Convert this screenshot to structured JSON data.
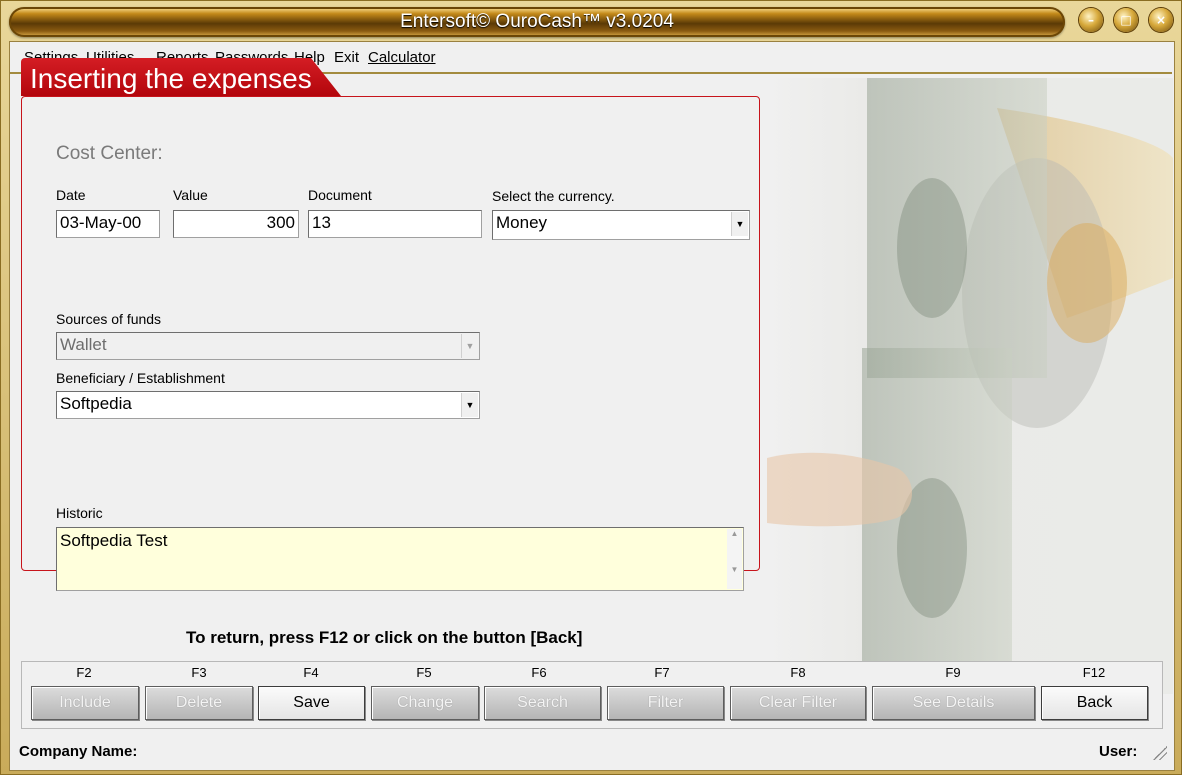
{
  "window": {
    "title": "Entersoft© OuroCash™ v3.0204"
  },
  "menu": [
    "Settings",
    "Utilities",
    "Reports",
    "Passwords",
    "Help",
    "Exit",
    "Calculator"
  ],
  "panel": {
    "tab_title": "Inserting the expenses",
    "cost_center": "Cost Center:",
    "date_label": "Date",
    "date_value": "03-May-00",
    "value_label": "Value",
    "value_value": "300",
    "document_label": "Document",
    "document_value": "13",
    "currency_label": "Select the currency.",
    "currency_value": "Money",
    "sources_label": "Sources of funds",
    "sources_value": "Wallet",
    "beneficiary_label": "Beneficiary / Establishment",
    "beneficiary_value": "Softpedia",
    "historic_label": "Historic",
    "historic_value": "Softpedia Test"
  },
  "hint": "To return, press F12 or click on the button [Back]",
  "buttons": [
    {
      "key": "F2",
      "label": "Include",
      "enabled": false
    },
    {
      "key": "F3",
      "label": "Delete",
      "enabled": false
    },
    {
      "key": "F4",
      "label": "Save",
      "enabled": true
    },
    {
      "key": "F5",
      "label": "Change",
      "enabled": false
    },
    {
      "key": "F6",
      "label": "Search",
      "enabled": false
    },
    {
      "key": "F7",
      "label": "Filter",
      "enabled": false
    },
    {
      "key": "F8",
      "label": "Clear Filter",
      "enabled": false
    },
    {
      "key": "F9",
      "label": "See Details",
      "enabled": false
    },
    {
      "key": "F12",
      "label": "Back",
      "enabled": true
    }
  ],
  "status": {
    "company": "Company Name:",
    "user": "User:"
  },
  "icons": [
    "minimize-icon",
    "maximize-icon",
    "close-icon",
    "dropdown-arrow-icon",
    "money-roll-image"
  ]
}
